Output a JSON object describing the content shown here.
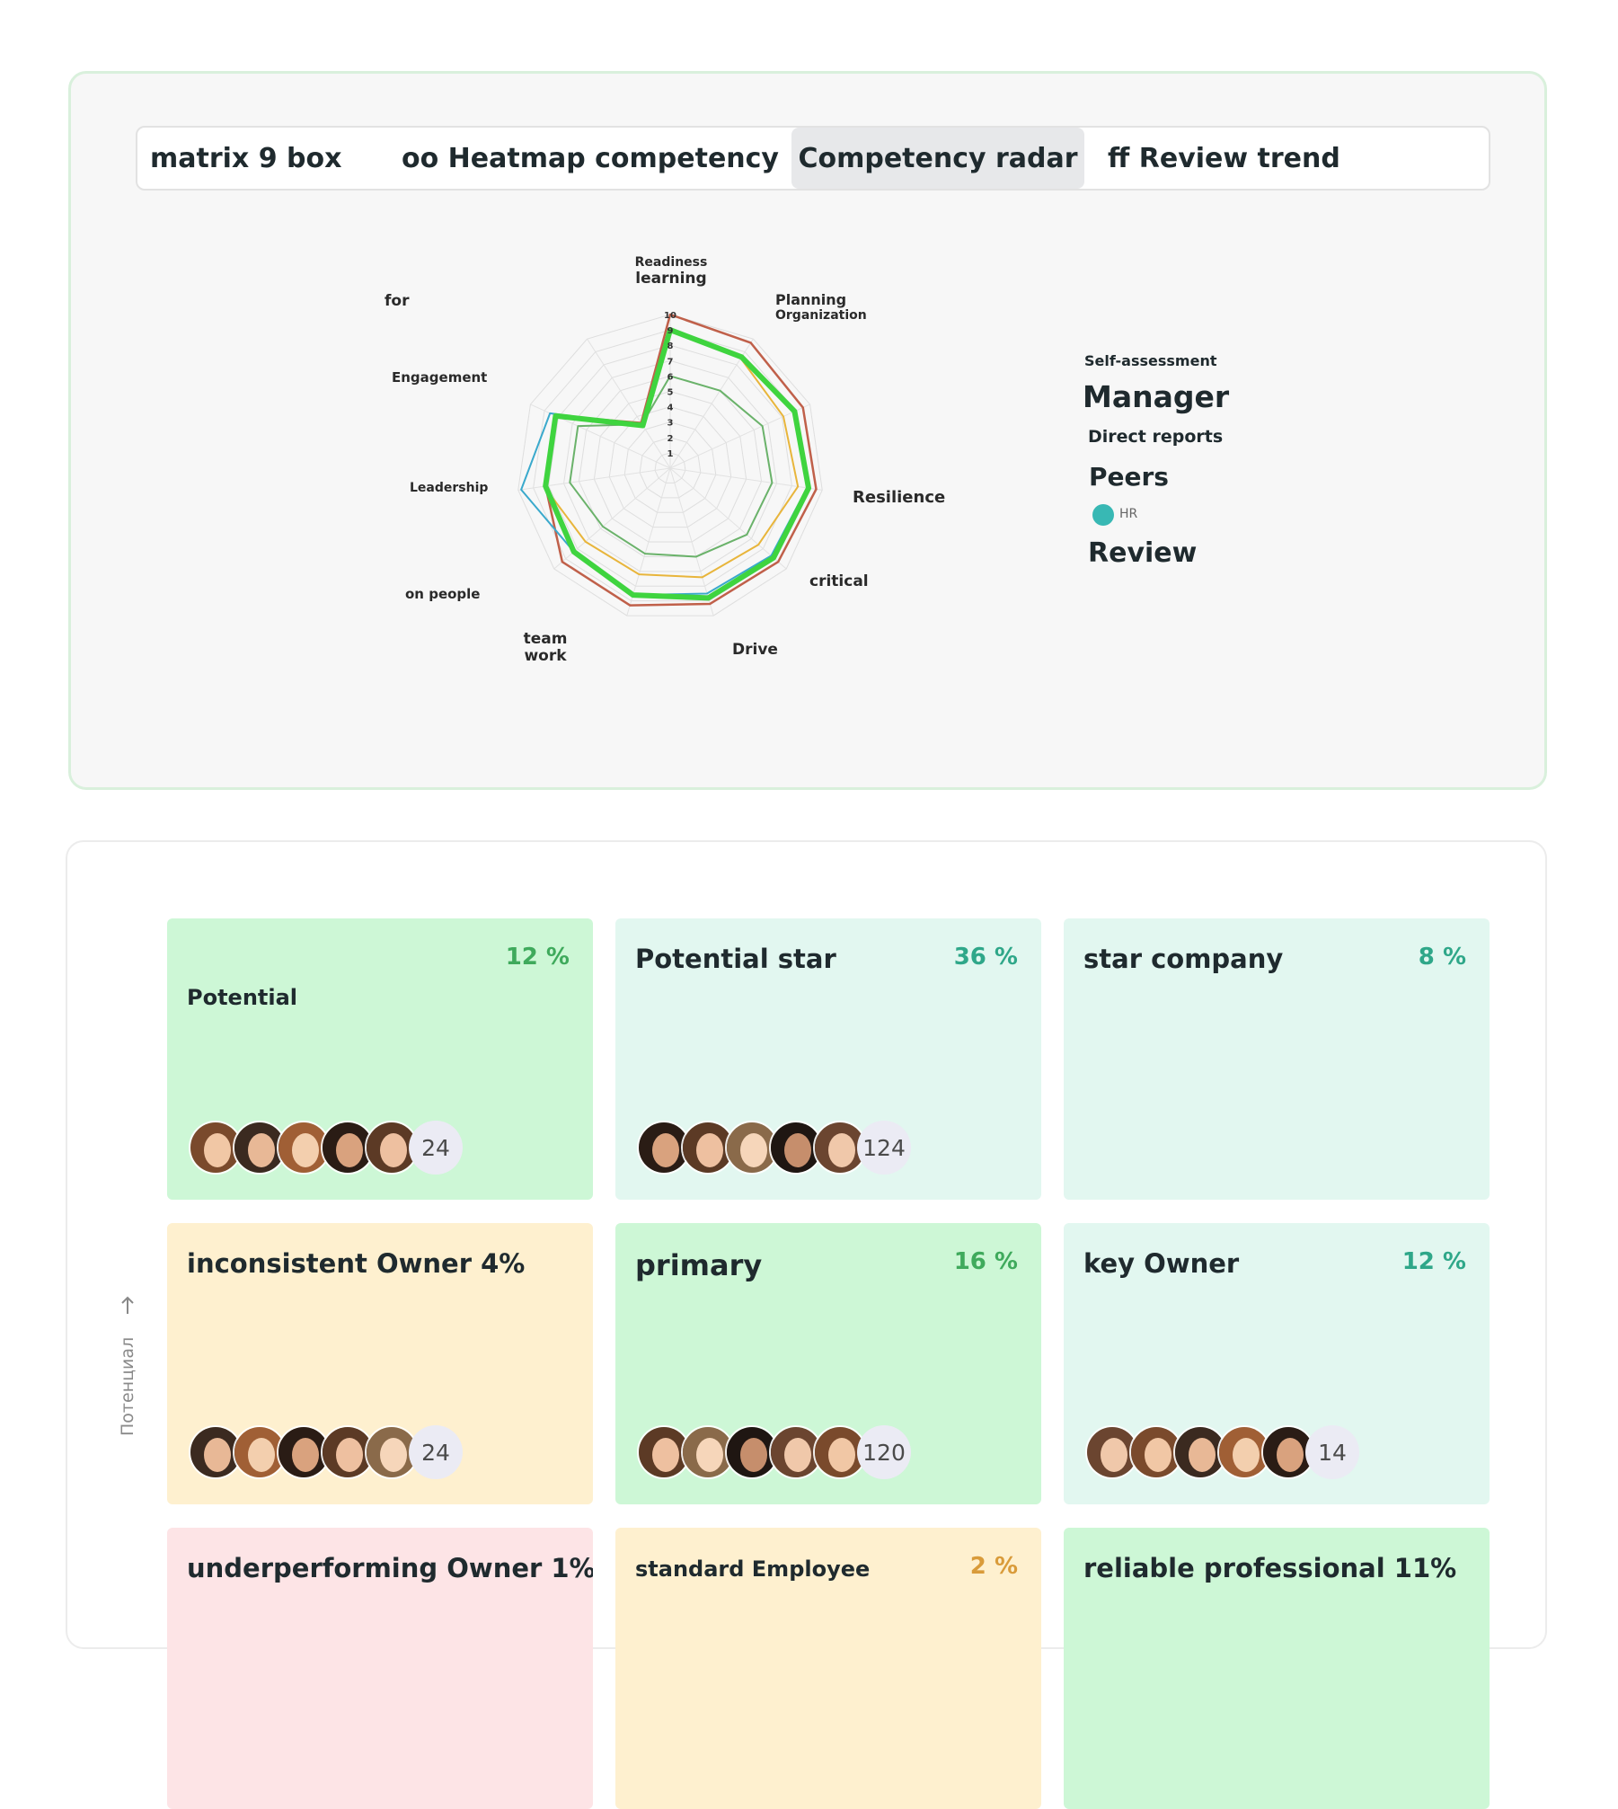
{
  "tabs": [
    {
      "label": "matrix 9 box"
    },
    {
      "label": "oo Heatmap competency"
    },
    {
      "label": "Competency radar",
      "active": true
    },
    {
      "label": "ff Review trend"
    }
  ],
  "radar": {
    "axes": [
      {
        "line1": "Readiness",
        "line2": "learning"
      },
      {
        "line1": "Planning",
        "line2": "Organization"
      },
      {
        "line1": "",
        "line2": ""
      },
      {
        "line1": "Resilience",
        "line2": ""
      },
      {
        "line1": "critical",
        "line2": ""
      },
      {
        "line1": "Drive",
        "line2": ""
      },
      {
        "line1": "team",
        "line2": "work"
      },
      {
        "line1": "on people",
        "line2": ""
      },
      {
        "line1": "Leadership",
        "line2": ""
      },
      {
        "line1": "Engagement",
        "line2": ""
      },
      {
        "line1": "for",
        "line2": ""
      }
    ],
    "ticks": [
      "1",
      "2",
      "3",
      "4",
      "5",
      "6",
      "7",
      "8",
      "9",
      "10"
    ],
    "max": 10,
    "series": [
      {
        "key": "manager",
        "color": "#c0604a",
        "width": 2.5,
        "values": [
          10,
          9.7,
          9.5,
          9.6,
          9.3,
          9.2,
          9.3,
          9.3,
          8.2,
          8.2,
          3.5
        ]
      },
      {
        "key": "peers",
        "color": "#3aa9cc",
        "width": 2,
        "values": [
          9,
          8.6,
          8.8,
          9,
          8.7,
          8.5,
          8.6,
          8.3,
          9.8,
          8.6,
          3.3
        ]
      },
      {
        "key": "direct",
        "color": "#e8b53b",
        "width": 2,
        "values": [
          8.9,
          8.5,
          8.1,
          8.4,
          7.6,
          7.4,
          7.2,
          7.3,
          8.3,
          8.2,
          3.3
        ]
      },
      {
        "key": "self",
        "color": "#6ab26a",
        "width": 2,
        "values": [
          6,
          6,
          6.6,
          6.7,
          6.6,
          6,
          5.8,
          5.8,
          6.6,
          6.6,
          3.4
        ]
      },
      {
        "key": "review",
        "color": "#3fd43f",
        "width": 6,
        "values": [
          9,
          8.6,
          8.9,
          9.1,
          8.9,
          8.8,
          8.6,
          8.3,
          8.2,
          8.2,
          3.3
        ]
      }
    ]
  },
  "legend": {
    "self": "Self-assessment",
    "manager": "Manager",
    "direct": "Direct reports",
    "peers": "Peers",
    "hr": "HR",
    "review": "Review"
  },
  "matrix": {
    "axis_label": "Потенциал",
    "cells": [
      {
        "title": "Potential",
        "pct": "12 %",
        "count": "24",
        "bg": "#cdf7d6",
        "pct_color": "#3faa5c"
      },
      {
        "title": "Potential star",
        "pct": "36 %",
        "count": "124",
        "bg": "#e2f7f0",
        "pct_color": "#2fa789"
      },
      {
        "title": "star company",
        "pct": "8 %",
        "count": "",
        "bg": "#e2f7f0",
        "pct_color": "#2fa789"
      },
      {
        "title": "inconsistent Owner 4%",
        "pct": "",
        "count": "24",
        "bg": "#fef0cf",
        "pct_color": "#d99b3a"
      },
      {
        "title": "primary",
        "pct": "16 %",
        "count": "120",
        "bg": "#cdf7d6",
        "pct_color": "#3faa5c"
      },
      {
        "title": "key Owner",
        "pct": "12 %",
        "count": "14",
        "bg": "#e2f7f0",
        "pct_color": "#2fa789"
      },
      {
        "title": "underperforming Owner 1%",
        "pct": "",
        "count": "",
        "bg": "#fde4e6",
        "pct_color": "#cc5566"
      },
      {
        "title": "standard Employee",
        "pct": "2 %",
        "count": "",
        "bg": "#fef0cf",
        "pct_color": "#d99b3a"
      },
      {
        "title": "reliable professional 11%",
        "pct": "",
        "count": "",
        "bg": "#cdf7d6",
        "pct_color": "#3faa5c"
      }
    ]
  }
}
